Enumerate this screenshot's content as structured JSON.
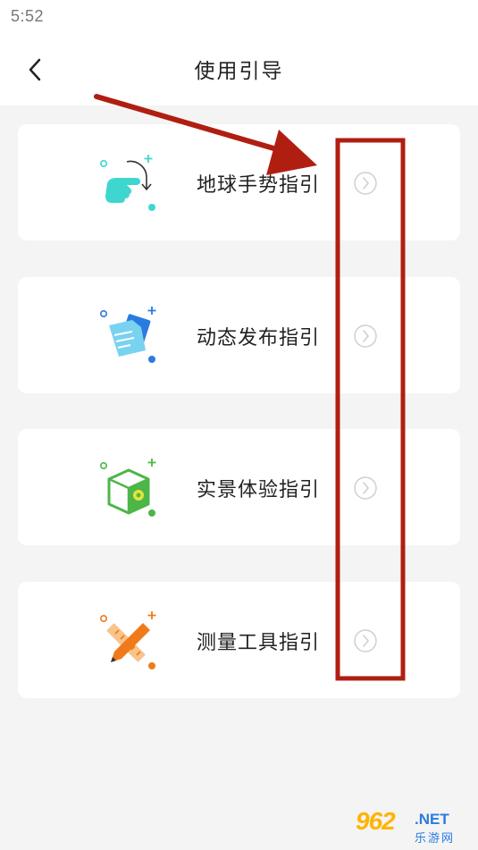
{
  "status_bar": {
    "time": "5:52"
  },
  "header": {
    "title": "使用引导",
    "back_icon": "chevron-left-icon"
  },
  "guides": [
    {
      "label": "地球手势指引",
      "icon": "hand-gesture-icon",
      "accent": "#3fd6d0"
    },
    {
      "label": "动态发布指引",
      "icon": "document-publish-icon",
      "accent": "#2a7be0"
    },
    {
      "label": "实景体验指引",
      "icon": "cube-location-icon",
      "accent": "#4cb648"
    },
    {
      "label": "测量工具指引",
      "icon": "pencil-ruler-icon",
      "accent": "#f07a1a"
    }
  ],
  "annotation_color": "#b01e12",
  "watermark": {
    "number": "962",
    "domain": ".NET",
    "site": "乐游网"
  }
}
